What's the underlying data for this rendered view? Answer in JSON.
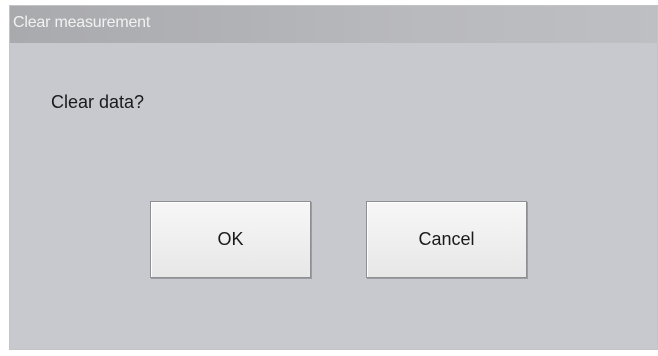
{
  "dialog": {
    "title": "Clear measurement",
    "message": "Clear data?",
    "ok_label": "OK",
    "cancel_label": "Cancel"
  }
}
